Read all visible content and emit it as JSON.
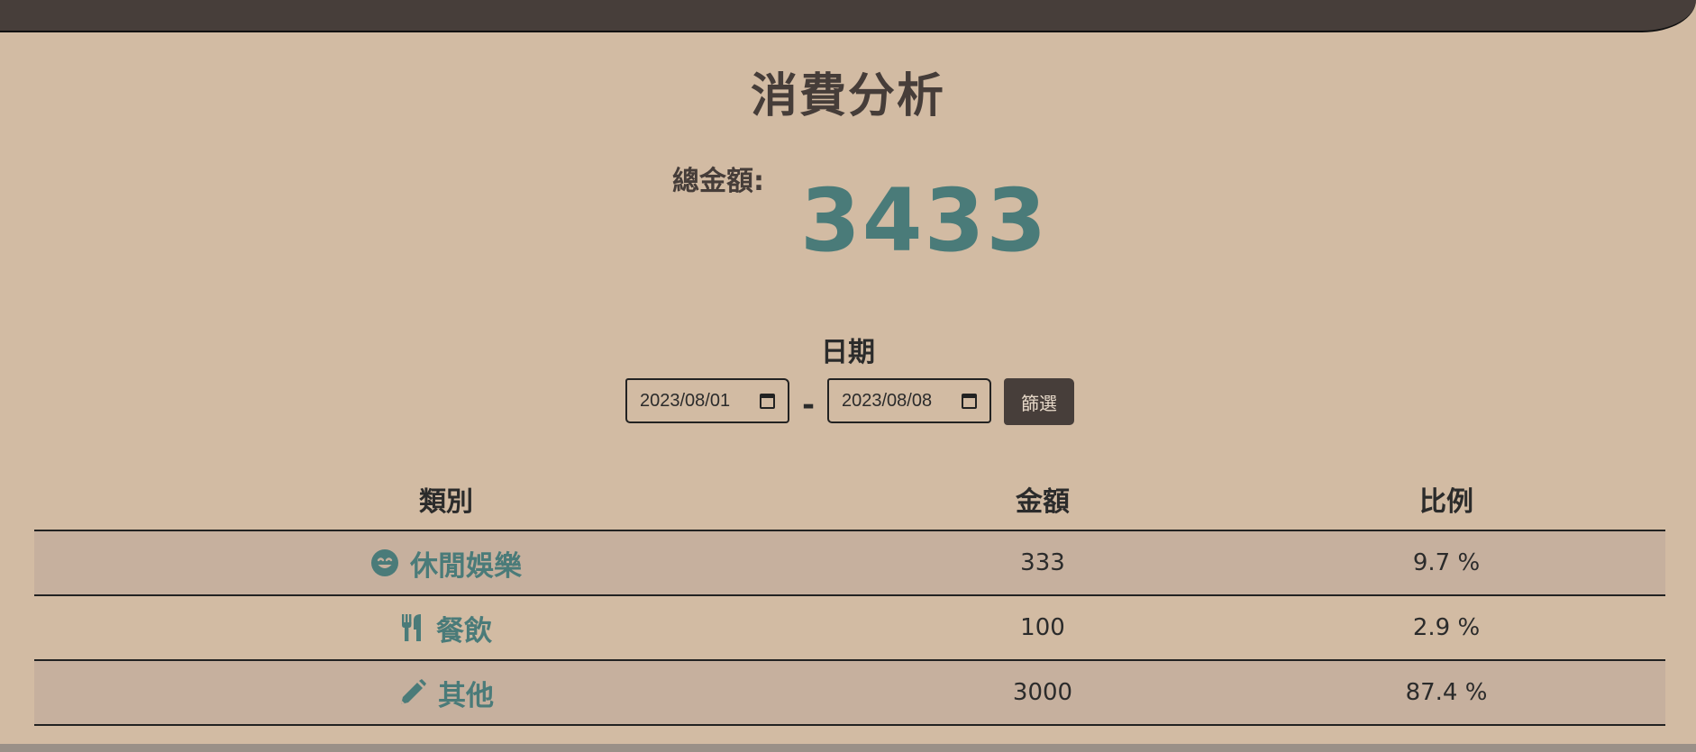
{
  "page": {
    "title": "消費分析"
  },
  "summary": {
    "total_label": "總金額:",
    "total_value": "3433"
  },
  "filter": {
    "date_label": "日期",
    "start_date": "2023/08/01",
    "end_date": "2023/08/08",
    "separator": "-",
    "button_label": "篩選"
  },
  "table": {
    "headers": [
      "類別",
      "金額",
      "比例"
    ],
    "rows": [
      {
        "icon": "smile-icon",
        "category": "休閒娛樂",
        "amount": "333",
        "percent": "9.7 %"
      },
      {
        "icon": "utensils-icon",
        "category": "餐飲",
        "amount": "100",
        "percent": "2.9 %"
      },
      {
        "icon": "pencil-icon",
        "category": "其他",
        "amount": "3000",
        "percent": "87.4 %"
      }
    ]
  },
  "colors": {
    "background": "#d2bba3",
    "topbar": "#473e3a",
    "accent": "#4a7b79",
    "row_shade": "#c6b09e"
  }
}
